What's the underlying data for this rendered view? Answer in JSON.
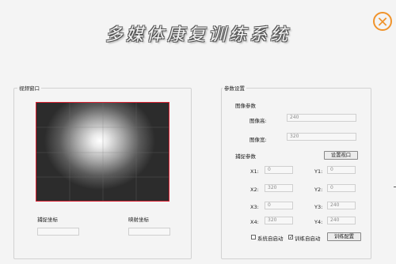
{
  "app": {
    "title": "多媒体康复训练系统"
  },
  "window": {
    "close_symbol": "✕"
  },
  "video_panel": {
    "label": "视频窗口",
    "capture_label": "捕捉坐标",
    "capture_value": "",
    "mapping_label": "映射坐标",
    "mapping_value": ""
  },
  "settings": {
    "label": "参数设置",
    "image_params_label": "图像参数",
    "height_label": "图像高:",
    "height_value": "240",
    "width_label": "图像宽:",
    "width_value": "320",
    "capture_params_label": "捕捉参数",
    "set_window_button": "设置视口",
    "x1_label": "X1:",
    "x1_value": "0",
    "y1_label": "Y1:",
    "y1_value": "0",
    "x2_label": "X2:",
    "x2_value": "320",
    "y2_label": "Y2:",
    "y2_value": "0",
    "x3_label": "X3:",
    "x3_value": "0",
    "y3_label": "Y3:",
    "y3_value": "240",
    "x4_label": "X4:",
    "x4_value": "320",
    "y4_label": "Y4:",
    "y4_value": "240",
    "system_autostart_label": "系统自启动",
    "system_autostart_checked": false,
    "training_autostart_label": "训练自启动",
    "training_autostart_checked": true,
    "checkmark": "✓",
    "training_config_button": "训练配置"
  }
}
